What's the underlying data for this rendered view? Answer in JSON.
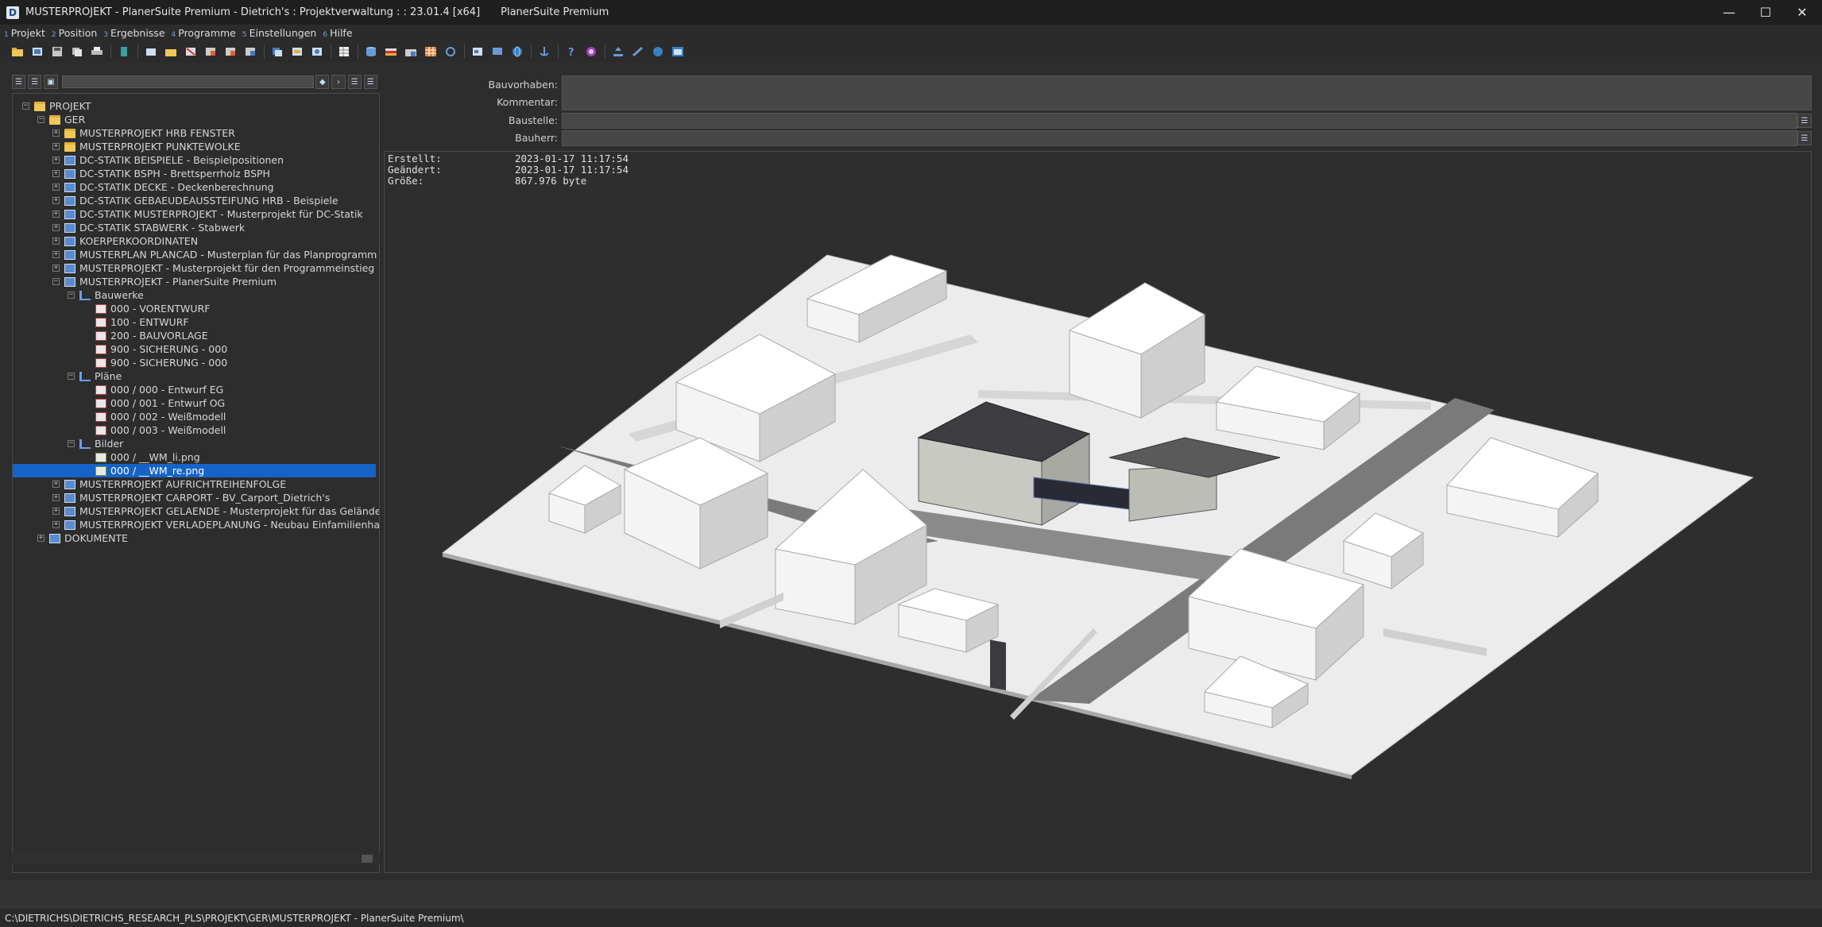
{
  "window": {
    "title": "MUSTERPROJEKT - PlanerSuite Premium - Dietrich's : Projektverwaltung : : 23.01.4 [x64]",
    "subtitle": "PlanerSuite Premium"
  },
  "menu": [
    {
      "num": "1",
      "label": "Projekt"
    },
    {
      "num": "2",
      "label": "Position"
    },
    {
      "num": "3",
      "label": "Ergebnisse"
    },
    {
      "num": "4",
      "label": "Programme"
    },
    {
      "num": "5",
      "label": "Einstellungen"
    },
    {
      "num": "6",
      "label": "Hilfe"
    }
  ],
  "tree": {
    "root": "PROJEKT",
    "ger": "GER",
    "items": [
      "MUSTERPROJEKT HRB FENSTER",
      "MUSTERPROJEKT PUNKTEWOLKE",
      "DC-STATIK BEISPIELE - Beispielpositionen",
      "DC-STATIK BSPH - Brettsperrholz BSPH",
      "DC-STATIK DECKE - Deckenberechnung",
      "DC-STATIK GEBAEUDEAUSSTEIFUNG HRB - Beispiele",
      "DC-STATIK MUSTERPROJEKT - Musterprojekt für DC-Statik",
      "DC-STATIK STABWERK - Stabwerk",
      "KOERPERKOORDINATEN",
      "MUSTERPLAN PLANCAD - Musterplan für das Planprogramm",
      "MUSTERPROJEKT - Musterprojekt für den Programmeinstieg",
      "MUSTERPROJEKT - PlanerSuite Premium"
    ],
    "bauwerke": "Bauwerke",
    "bauwerke_items": [
      "000 - VORENTWURF",
      "100 - ENTWURF",
      "200 - BAUVORLAGE",
      "900 - SICHERUNG - 000",
      "900 - SICHERUNG - 000"
    ],
    "plaene": "Pläne",
    "plaene_items": [
      "000 / 000 - Entwurf EG",
      "000 / 001 - Entwurf OG",
      "000 / 002 - Weißmodell",
      "000 / 003 - Weißmodell"
    ],
    "bilder": "Bilder",
    "bilder_items": [
      "000 / __WM_li.png",
      "000 / __WM_re.png"
    ],
    "more_items": [
      "MUSTERPROJEKT AUFRICHTREIHENFOLGE",
      "MUSTERPROJEKT CARPORT - BV_Carport_Dietrich's",
      "MUSTERPROJEKT GELAENDE - Musterprojekt für das Geländemo",
      "MUSTERPROJEKT VERLADEPLANUNG - Neubau Einfamilienhaus"
    ],
    "dokumente": "DOKUMENTE"
  },
  "form": {
    "bauvorhaben": "Bauvorhaben:",
    "kommentar": "Kommentar:",
    "baustelle": "Baustelle:",
    "bauherr": "Bauherr:"
  },
  "info": {
    "erstellt_label": "Erstellt:",
    "erstellt": "2023-01-17 11:17:54",
    "geaendert_label": "Geändert:",
    "geaendert": "2023-01-17 11:17:54",
    "groesse_label": "Größe:",
    "groesse": "867.976 byte"
  },
  "status": {
    "path": "C:\\DIETRICHS\\DIETRICHS_RESEARCH_PLS\\PROJEKT\\GER\\MUSTERPROJEKT - PlanerSuite Premium\\"
  },
  "icons": {
    "app": "D",
    "minimize": "—",
    "maximize": "☐",
    "close": "✕"
  }
}
